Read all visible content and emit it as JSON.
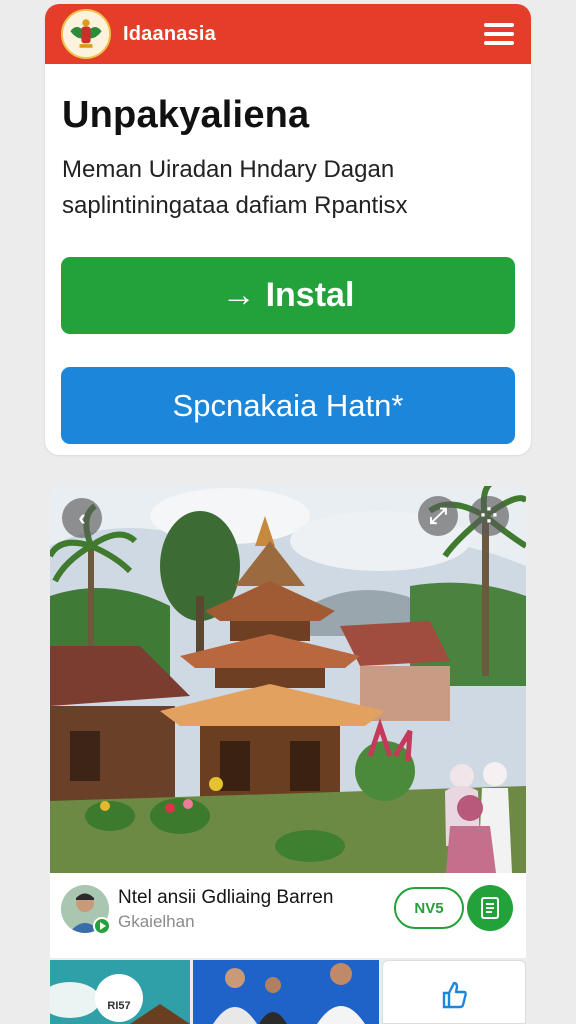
{
  "header": {
    "app_name": "Idaanasia",
    "logo_icon": "garuda-emblem-icon",
    "menu_icon": "hamburger-menu-icon",
    "bg_color": "#e43d2a"
  },
  "main": {
    "title": "Unpakyaliena",
    "subtitle": "Meman Uiradan Hndary Dagan saplintiningataa dafiam Rpantisx",
    "install_button": {
      "icon": "→",
      "label": "Instal",
      "color": "#23a13a"
    },
    "second_button": {
      "label": "Spcnakaia Hatn*",
      "color": "#1c86db"
    }
  },
  "media": {
    "photo_icons": [
      "back-icon",
      "share-icon",
      "grid-icon"
    ],
    "back_glyph": "‹",
    "share_glyph": "⤢",
    "grid_glyph": "⁘",
    "video_title": "Ntel ansii Gdliaing Barren",
    "channel_name": "Gkaielhan",
    "pill_label": "NV5",
    "action_icon": "document-icon"
  },
  "bottom_strip": {
    "thumb1_badge": "RI57",
    "thumb3_icon": "thumbs-up-icon"
  }
}
